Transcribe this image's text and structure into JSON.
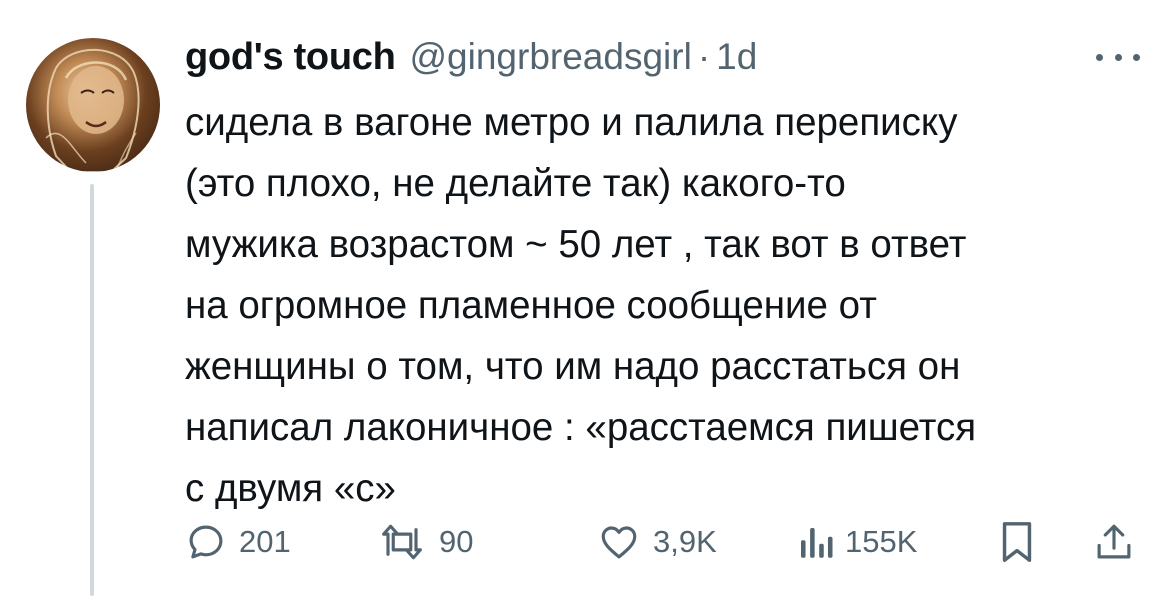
{
  "tweet": {
    "author": {
      "display_name": "god's touch",
      "handle": "@gingrbreadsgirl",
      "separator": "·",
      "time_ago": "1d"
    },
    "text_lines": [
      "сидела в вагоне метро и палила переписку",
      "(это плохо, не делайте так) какого-то",
      "мужика возрастом ~ 50 лет , так вот в ответ",
      "на огромное пламенное сообщение от",
      "женщины о том, что им надо расстаться он",
      "написал лаконичное : «расстаемся пишется",
      "с двумя «с»"
    ],
    "stats": {
      "replies": "201",
      "retweets": "90",
      "likes": "3,9K",
      "views": "155K"
    },
    "icons": {
      "more": "more-horizontal-icon",
      "reply": "reply-bubble-icon",
      "retweet": "retweet-icon",
      "like": "heart-icon",
      "views": "bar-chart-icon",
      "bookmark": "bookmark-icon",
      "share": "share-upload-icon"
    },
    "colors": {
      "text_primary": "#0f1419",
      "text_secondary": "#536471",
      "thread_line": "#cfd9de",
      "background": "#ffffff"
    }
  }
}
